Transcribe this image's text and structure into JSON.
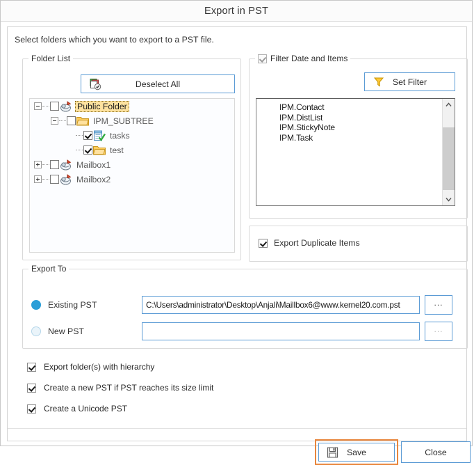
{
  "window": {
    "title": "Export in PST"
  },
  "instruction": "Select folders which you want to export to a PST file.",
  "folder_list": {
    "legend": "Folder List",
    "deselect_all_label": "Deselect All",
    "deselect_all_icon": "deselect-all-icon",
    "tree": [
      {
        "label": "Public Folder",
        "depth": 0,
        "expander": "minus",
        "checked": false,
        "icon": "mailbox-icon",
        "selected": true
      },
      {
        "label": "IPM_SUBTREE",
        "depth": 1,
        "expander": "minus",
        "checked": false,
        "icon": "folder-icon",
        "selected": false
      },
      {
        "label": "tasks",
        "depth": 2,
        "expander": "none",
        "checked": true,
        "icon": "tasks-icon",
        "selected": false
      },
      {
        "label": "test",
        "depth": 2,
        "expander": "none",
        "checked": true,
        "icon": "folder-icon",
        "selected": false
      },
      {
        "label": "Mailbox1",
        "depth": 0,
        "expander": "plus",
        "checked": false,
        "icon": "mailbox-icon",
        "selected": false
      },
      {
        "label": "Mailbox2",
        "depth": 0,
        "expander": "plus",
        "checked": false,
        "icon": "mailbox-icon",
        "selected": false
      }
    ]
  },
  "filter": {
    "legend": "Filter Date and Items",
    "legend_checked": true,
    "legend_disabled": true,
    "set_filter_label": "Set Filter",
    "set_filter_icon": "funnel-icon",
    "items": [
      "IPM.Contact",
      "IPM.DistList",
      "IPM.StickyNote",
      "IPM.Task"
    ],
    "scroll_up_icon": "chevron-up-icon",
    "scroll_down_icon": "chevron-down-icon"
  },
  "duplicates": {
    "label": "Export Duplicate Items",
    "checked": true
  },
  "export_to": {
    "legend": "Export To",
    "existing": {
      "label": "Existing PST",
      "selected": true,
      "path": "C:\\Users\\administrator\\Desktop\\Anjali\\Maillbox6@www.kernel20.com.pst",
      "browse_label": "..."
    },
    "new": {
      "label": "New PST",
      "selected": false,
      "path": "",
      "browse_label": "..."
    }
  },
  "options": [
    {
      "label": "Export folder(s) with hierarchy",
      "checked": true
    },
    {
      "label": "Create a new PST if PST reaches its size limit",
      "checked": true
    },
    {
      "label": "Create a Unicode PST",
      "checked": true
    }
  ],
  "footer": {
    "save_label": "Save",
    "save_icon": "floppy-save-icon",
    "close_label": "Close",
    "save_focus_color": "#e8863c"
  }
}
